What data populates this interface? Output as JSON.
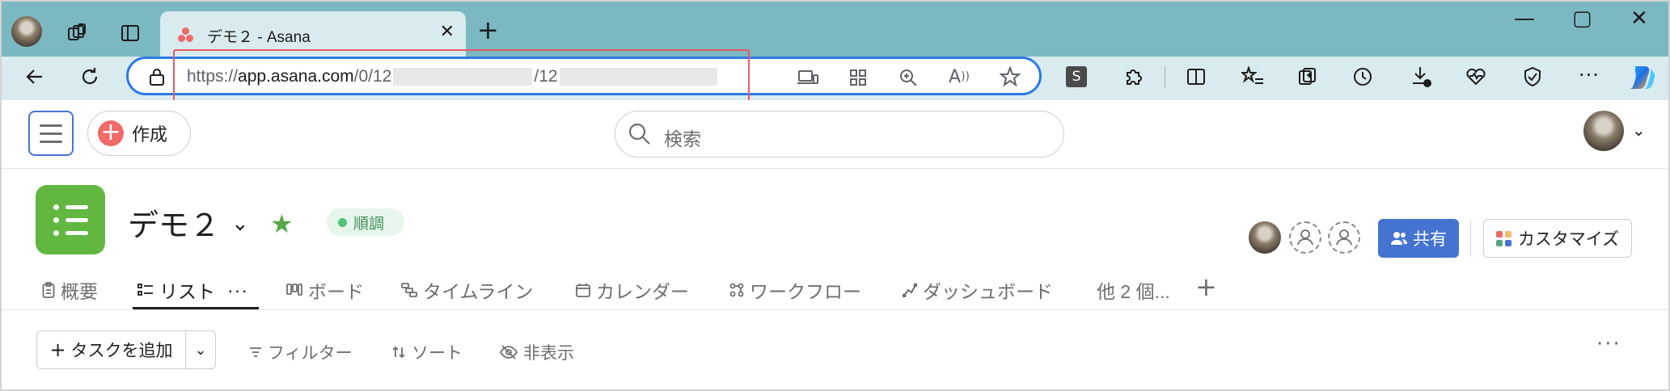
{
  "browser": {
    "tab": {
      "title": "デモ２ - Asana"
    },
    "url": {
      "prefix": "https://",
      "host": "app.asana.com",
      "path1": "/0/12",
      "path2": "/12"
    },
    "window_controls": {
      "minimize": "—",
      "maximize": "▢",
      "close": "✕"
    }
  },
  "app": {
    "create_label": "作成",
    "search_placeholder": "検索"
  },
  "project": {
    "title": "デモ２",
    "status": "順調",
    "share_label": "共有",
    "customize_label": "カスタマイズ",
    "tabs": [
      {
        "label": "概要",
        "icon": "clipboard-icon"
      },
      {
        "label": "リスト",
        "icon": "list-icon",
        "more": "···"
      },
      {
        "label": "ボード",
        "icon": "board-icon"
      },
      {
        "label": "タイムライン",
        "icon": "timeline-icon"
      },
      {
        "label": "カレンダー",
        "icon": "calendar-icon"
      },
      {
        "label": "ワークフロー",
        "icon": "workflow-icon"
      },
      {
        "label": "ダッシュボード",
        "icon": "dashboard-icon"
      },
      {
        "label": "他 2 個..."
      }
    ]
  },
  "actions": {
    "add_task": "タスクを追加",
    "filter": "フィルター",
    "sort": "ソート",
    "hide": "非表示"
  },
  "colors": {
    "accent_blue": "#4573d2",
    "asana_coral": "#f06a6a",
    "project_green": "#61b740",
    "status_green": "#4ec27a"
  }
}
